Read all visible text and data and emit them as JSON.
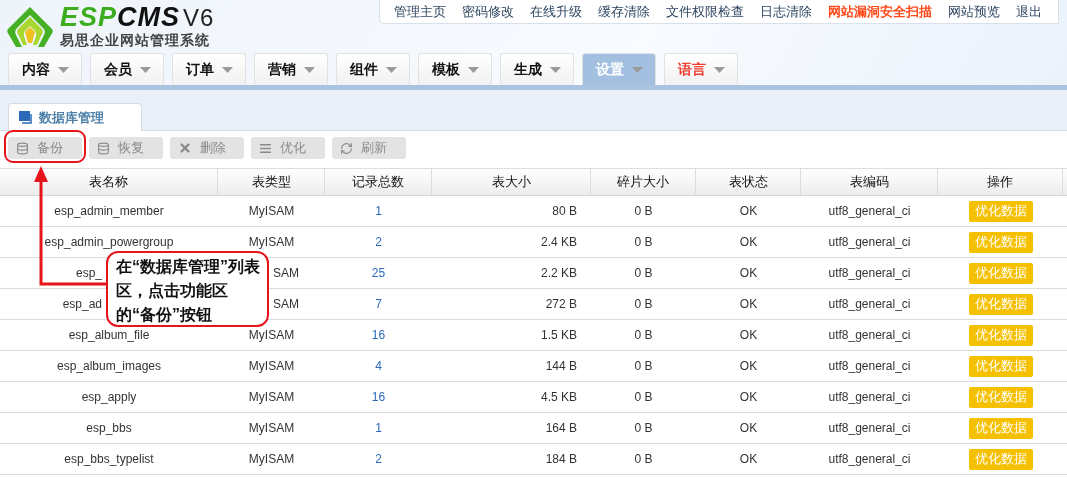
{
  "logo": {
    "brand_primary": "ESP",
    "brand_secondary": "CMS",
    "version": "V6",
    "subtitle": "易思企业网站管理系统"
  },
  "top_links": [
    {
      "label": "管理主页",
      "highlight": false
    },
    {
      "label": "密码修改",
      "highlight": false
    },
    {
      "label": "在线升级",
      "highlight": false
    },
    {
      "label": "缓存清除",
      "highlight": false
    },
    {
      "label": "文件权限检查",
      "highlight": false
    },
    {
      "label": "日志清除",
      "highlight": false
    },
    {
      "label": "网站漏洞安全扫描",
      "highlight": true
    },
    {
      "label": "网站预览",
      "highlight": false
    },
    {
      "label": "退出",
      "highlight": false
    }
  ],
  "nav": [
    {
      "label": "内容",
      "selected": false,
      "highlight": false
    },
    {
      "label": "会员",
      "selected": false,
      "highlight": false
    },
    {
      "label": "订单",
      "selected": false,
      "highlight": false
    },
    {
      "label": "营销",
      "selected": false,
      "highlight": false
    },
    {
      "label": "组件",
      "selected": false,
      "highlight": false
    },
    {
      "label": "模板",
      "selected": false,
      "highlight": false
    },
    {
      "label": "生成",
      "selected": false,
      "highlight": false
    },
    {
      "label": "设置",
      "selected": true,
      "highlight": false
    },
    {
      "label": "语言",
      "selected": false,
      "highlight": true
    }
  ],
  "panel_tab": {
    "label": "数据库管理"
  },
  "toolbar": [
    {
      "label": "备份",
      "kind": "backup"
    },
    {
      "label": "恢复",
      "kind": "restore"
    },
    {
      "label": "删除",
      "kind": "delete"
    },
    {
      "label": "优化",
      "kind": "optimize"
    },
    {
      "label": "刷新",
      "kind": "refresh"
    }
  ],
  "table": {
    "columns": [
      "表名称",
      "表类型",
      "记录总数",
      "表大小",
      "碎片大小",
      "表状态",
      "表编码",
      "操作"
    ],
    "rows": [
      {
        "cells": [
          "esp_admin_member",
          "MyISAM",
          "1",
          "80 B",
          "0 B",
          "OK",
          "utf8_general_ci"
        ],
        "action": "优化数据",
        "covered": false
      },
      {
        "cells": [
          "esp_admin_powergroup",
          "MyISAM",
          "2",
          "2.4 KB",
          "0 B",
          "OK",
          "utf8_general_ci"
        ],
        "action": "优化数据",
        "covered": false
      },
      {
        "cells": [
          "esp_",
          "SAM",
          "25",
          "2.2 KB",
          "0 B",
          "OK",
          "utf8_general_ci"
        ],
        "action": "优化数据",
        "covered": true
      },
      {
        "cells": [
          "esp_ad",
          "SAM",
          "7",
          "272 B",
          "0 B",
          "OK",
          "utf8_general_ci"
        ],
        "action": "优化数据",
        "covered": true
      },
      {
        "cells": [
          "esp_album_file",
          "MyISAM",
          "16",
          "1.5 KB",
          "0 B",
          "OK",
          "utf8_general_ci"
        ],
        "action": "优化数据",
        "covered": false
      },
      {
        "cells": [
          "esp_album_images",
          "MyISAM",
          "4",
          "144 B",
          "0 B",
          "OK",
          "utf8_general_ci"
        ],
        "action": "优化数据",
        "covered": false
      },
      {
        "cells": [
          "esp_apply",
          "MyISAM",
          "16",
          "4.5 KB",
          "0 B",
          "OK",
          "utf8_general_ci"
        ],
        "action": "优化数据",
        "covered": false
      },
      {
        "cells": [
          "esp_bbs",
          "MyISAM",
          "1",
          "164 B",
          "0 B",
          "OK",
          "utf8_general_ci"
        ],
        "action": "优化数据",
        "covered": false
      },
      {
        "cells": [
          "esp_bbs_typelist",
          "MyISAM",
          "2",
          "184 B",
          "0 B",
          "OK",
          "utf8_general_ci"
        ],
        "action": "优化数据",
        "covered": false
      }
    ]
  },
  "callout": {
    "text": "在“数据库管理”列表区，点击功能区的“备份”按钮"
  }
}
